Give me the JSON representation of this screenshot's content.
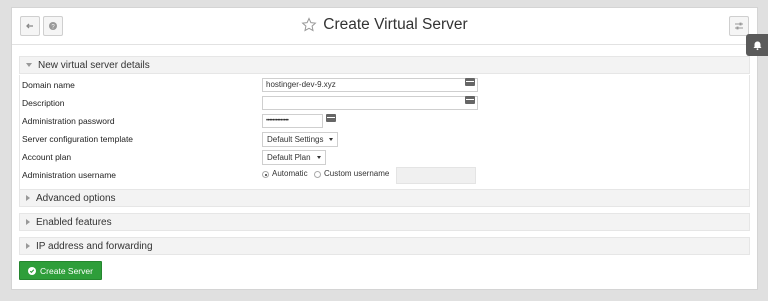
{
  "header": {
    "title": "Create Virtual Server",
    "back_icon": "back-arrow-icon",
    "help_icon": "help-icon",
    "star_icon": "star-icon",
    "config_icon": "settings-sliders-icon"
  },
  "side_tab": {
    "icon": "bell-icon"
  },
  "sections": {
    "details": "New virtual server details",
    "advanced": "Advanced options",
    "features": "Enabled features",
    "ip": "IP address and forwarding"
  },
  "form": {
    "domain_label": "Domain name",
    "domain_value": "hostinger-dev-9.xyz",
    "description_label": "Description",
    "description_value": "",
    "password_label": "Administration password",
    "password_value": "••••••••••••••",
    "template_label": "Server configuration template",
    "template_value": "Default Settings",
    "plan_label": "Account plan",
    "plan_value": "Default Plan",
    "username_label": "Administration username",
    "username_option_auto": "Automatic",
    "username_option_custom": "Custom username",
    "username_selected": "Automatic"
  },
  "actions": {
    "create_label": "Create Server"
  },
  "colors": {
    "accent_green": "#2e9e3a",
    "side_tab": "#5a5a5a"
  }
}
